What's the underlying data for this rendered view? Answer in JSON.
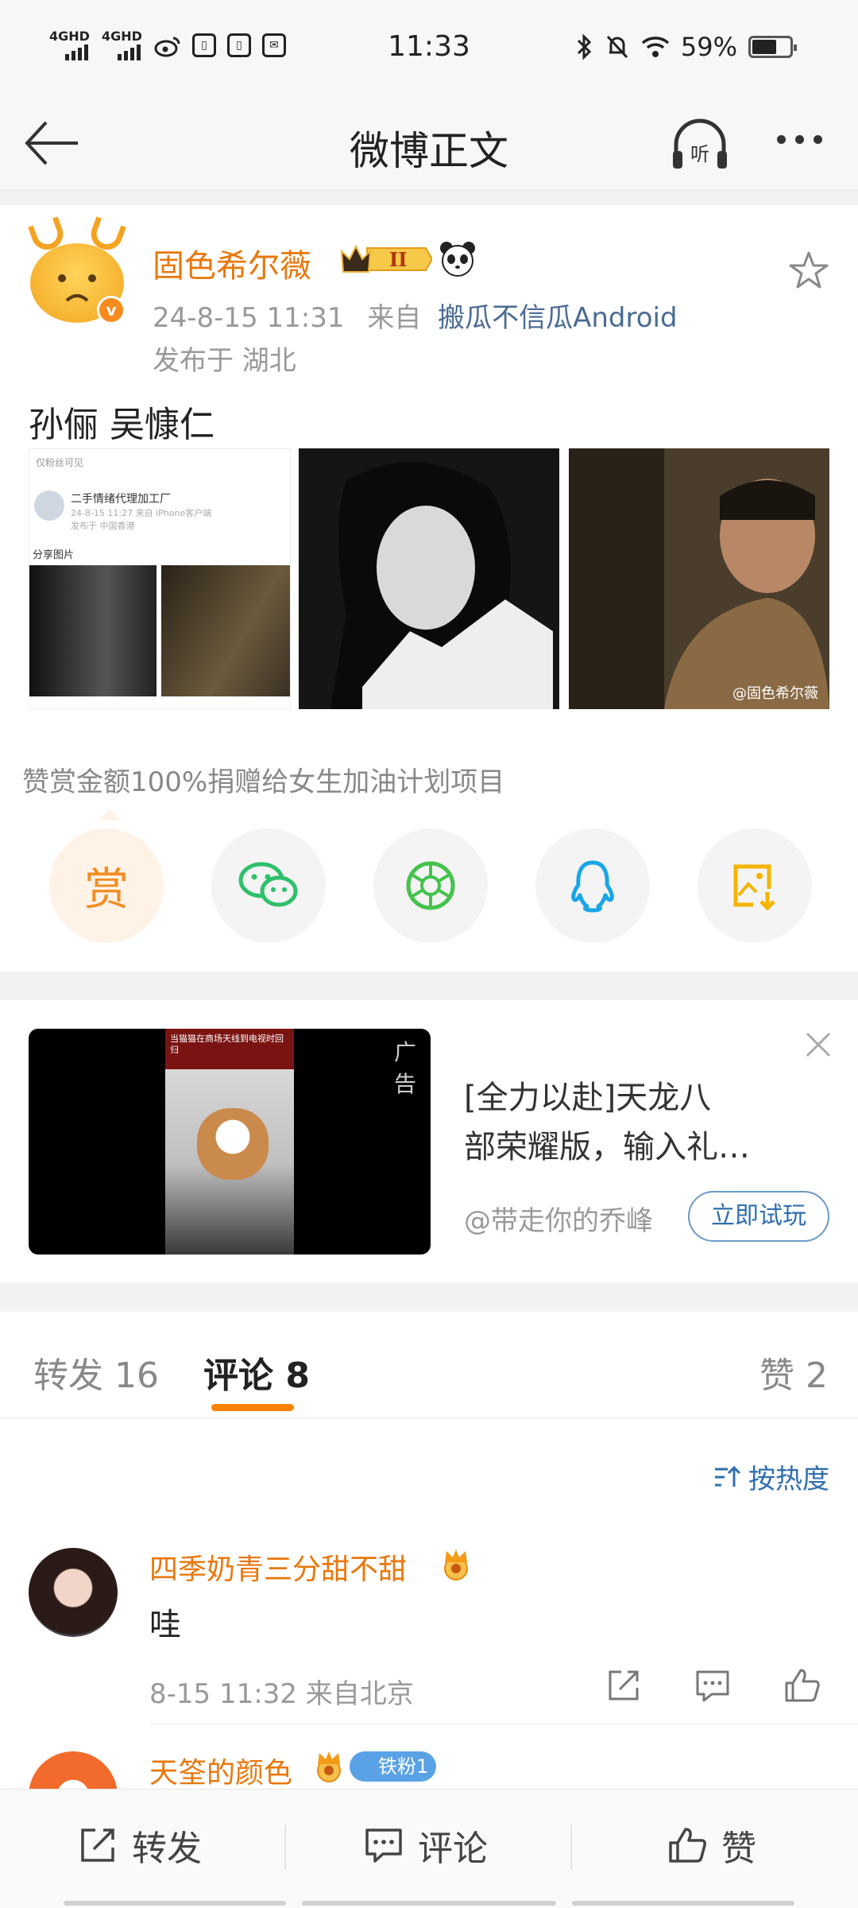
{
  "status_bar": {
    "time": "11:33",
    "battery": "59%",
    "network_left": "4GHD",
    "network_right": "4GHD",
    "battery_level": 0.59
  },
  "nav": {
    "title": "微博正文",
    "listen_label": "听"
  },
  "post": {
    "author": "固色希尔薇",
    "time": "24-8-15 11:31",
    "from_prefix": "来自",
    "source": "搬瓜不信瓜Android",
    "location": "发布于 湖北",
    "text": "孙俪 吴慷仁",
    "image1": {
      "top_note": "仅粉丝可见",
      "author": "二手情绪代理加工厂",
      "meta": "24-8-15 11:27 来自 iPhone客户端",
      "meta2": "发布于 中国香港",
      "share": "分享图片"
    },
    "image3_watermark": "@固色希尔薇",
    "donate_text": "赞赏金额100%捐赠给女生加油计划项目",
    "reward_label": "赏",
    "share_icons": [
      "reward-icon",
      "wechat-icon",
      "moments-icon",
      "qq-icon",
      "save-image-icon"
    ]
  },
  "ad": {
    "tag": "广告",
    "title_line1": "[全力以赴]天龙八",
    "title_line2": "部荣耀版，输入礼…",
    "author": "@带走你的乔峰",
    "cta": "立即试玩",
    "frame_text": "当猫猫在商场天线到电视时回归"
  },
  "tabs": {
    "repost": "转发 16",
    "comment": "评论 8",
    "like": "赞 2"
  },
  "comments": {
    "sort_label": "按热度",
    "items": [
      {
        "name": "四季奶青三分甜不甜",
        "text": "哇",
        "meta": "8-15 11:32 来自北京"
      },
      {
        "name": "天筌的颜色",
        "fan_badge": "铁粉1"
      }
    ]
  },
  "bottom_bar": {
    "repost": "转发",
    "comment": "评论",
    "like": "赞"
  },
  "colors": {
    "accent": "#ff8200",
    "username": "#e8770c",
    "link": "#2f6fb0"
  }
}
